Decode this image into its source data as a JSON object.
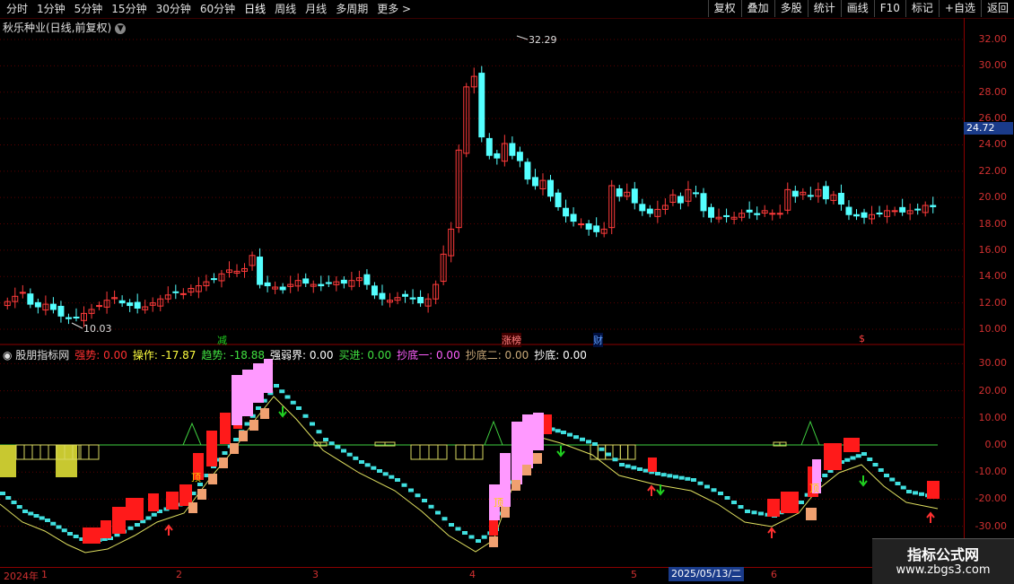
{
  "toolbar": {
    "periods": [
      "分时",
      "1分钟",
      "5分钟",
      "15分钟",
      "30分钟",
      "60分钟",
      "日线",
      "周线",
      "月线",
      "多周期",
      "更多 >"
    ],
    "active": "日线",
    "right_buttons": [
      "复权",
      "叠加",
      "多股",
      "统计",
      "画线",
      "F10",
      "标记",
      "+自选",
      "返回"
    ]
  },
  "chart_title": "秋乐种业(日线,前复权)",
  "price_axis": {
    "labels": [
      "32.00",
      "30.00",
      "28.00",
      "26.00",
      "24.00",
      "22.00",
      "20.00",
      "18.00",
      "16.00",
      "14.00",
      "12.00",
      "10.00"
    ],
    "current": "24.72"
  },
  "price_annotations": {
    "high": "32.29",
    "low": "10.03"
  },
  "event_labels": [
    {
      "text": "减",
      "color": "#20d020"
    },
    {
      "text": "涨榜",
      "color": "#ff8080"
    },
    {
      "text": "财",
      "color": "#60a0ff"
    },
    {
      "text": "$",
      "color": "#ff4040"
    }
  ],
  "indicator": {
    "name": "股朋指标网",
    "fields": [
      {
        "label": "强势: 0.00",
        "color": "#ff3030"
      },
      {
        "label": "操作: -17.87",
        "color": "#ffff40"
      },
      {
        "label": "趋势: -18.88",
        "color": "#40e040"
      },
      {
        "label": "强弱界: 0.00",
        "color": "#ffffff"
      },
      {
        "label": "买进: 0.00",
        "color": "#40e040"
      },
      {
        "label": "抄底一: 0.00",
        "color": "#ff60ff"
      },
      {
        "label": "抄底二: 0.00",
        "color": "#c8a878"
      },
      {
        "label": "抄底: 0.00",
        "color": "#ffffff"
      }
    ],
    "axis_labels": [
      "30.00",
      "20.00",
      "10.00",
      "0.00",
      "-10.00",
      "-20.00",
      "-30.00"
    ],
    "tops": [
      "顶",
      "顶",
      "顶"
    ]
  },
  "date_axis": {
    "labels": [
      "2024年",
      "1",
      "2",
      "3",
      "4",
      "5",
      "6"
    ],
    "selected": "2025/05/13/二"
  },
  "watermark": {
    "line1": "指标公式网",
    "line2": "www.zbgs3.com"
  },
  "chart_data": {
    "type": "candlestick",
    "title": "秋乐种业(日线,前复权)",
    "ylim": [
      10,
      32.5
    ],
    "close": [
      12.1,
      12.5,
      12.8,
      11.9,
      11.7,
      11.9,
      11.5,
      11.0,
      10.8,
      10.9,
      11.2,
      11.5,
      11.8,
      12.2,
      12.4,
      12.0,
      11.8,
      11.6,
      11.7,
      12.0,
      12.3,
      12.6,
      12.8,
      12.7,
      13.1,
      13.3,
      13.6,
      13.8,
      14.2,
      14.5,
      14.4,
      14.6,
      15.6,
      13.4,
      13.3,
      13.2,
      13.0,
      13.4,
      13.7,
      13.5,
      13.4,
      13.3,
      13.5,
      13.6,
      13.5,
      13.7,
      13.9,
      13.4,
      12.6,
      12.3,
      12.2,
      12.4,
      12.5,
      12.3,
      12.0,
      12.3,
      13.4,
      15.7,
      17.6,
      23.6,
      28.4,
      29.2,
      24.6,
      23.2,
      23.0,
      24.1,
      23.2,
      22.8,
      21.4,
      20.9,
      21.3,
      20.1,
      19.3,
      18.6,
      18.2,
      18.0,
      17.6,
      17.4,
      17.6,
      20.9,
      20.1,
      20.4,
      19.6,
      19.0,
      18.8,
      19.1,
      19.4,
      20.2,
      19.6,
      20.6,
      20.3,
      19.0,
      18.5,
      18.5,
      18.6,
      18.5,
      18.8,
      18.9,
      18.7,
      19.0,
      18.8,
      18.8,
      20.6,
      20.1,
      20.4,
      20.1,
      20.6,
      19.9,
      20.2,
      19.5,
      18.7,
      18.6,
      18.5,
      18.7,
      18.8,
      19.0,
      19.0,
      18.9,
      19.0,
      19.1,
      19.4,
      19.3
    ]
  }
}
